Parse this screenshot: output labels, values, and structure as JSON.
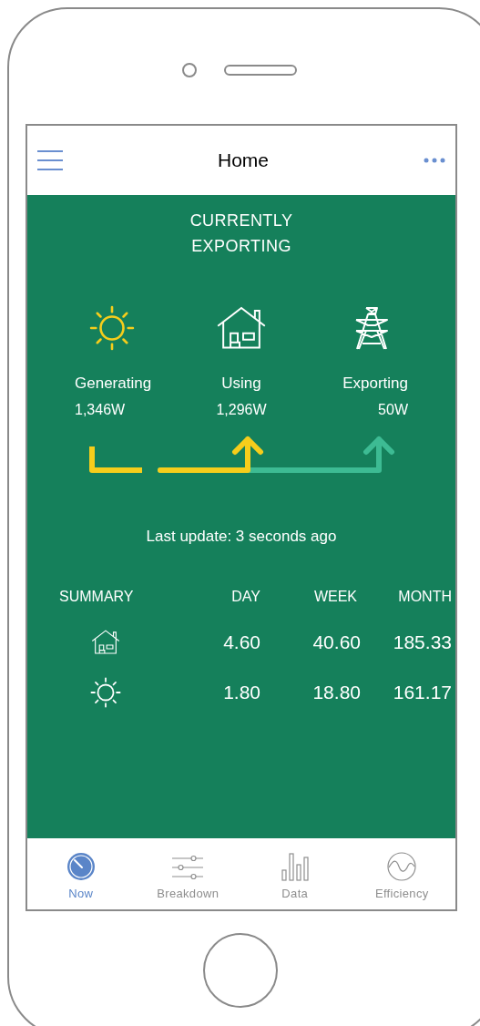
{
  "header": {
    "title": "Home"
  },
  "status": {
    "lines": [
      "CURRENTLY",
      "EXPORTING"
    ]
  },
  "flow": [
    {
      "kind": "sun",
      "label": "Generating",
      "value": "1,346W"
    },
    {
      "kind": "house",
      "label": "Using",
      "value": "1,296W"
    },
    {
      "kind": "pylon",
      "label": "Exporting",
      "value": "50W"
    }
  ],
  "last_update": "Last update: 3  seconds ago",
  "summary": {
    "columns": [
      "SUMMARY",
      "DAY",
      "WEEK",
      "MONTH"
    ],
    "rows": [
      {
        "kind": "house",
        "values": [
          "4.60",
          "40.60",
          "185.33"
        ]
      },
      {
        "kind": "sun",
        "values": [
          "1.80",
          "18.80",
          "161.17"
        ]
      }
    ]
  },
  "tabs": [
    {
      "kind": "gauge",
      "label": "Now",
      "selected": true
    },
    {
      "kind": "sliders",
      "label": "Breakdown",
      "selected": false
    },
    {
      "kind": "bars",
      "label": "Data",
      "selected": false
    },
    {
      "kind": "wave",
      "label": "Efficiency",
      "selected": false
    }
  ]
}
